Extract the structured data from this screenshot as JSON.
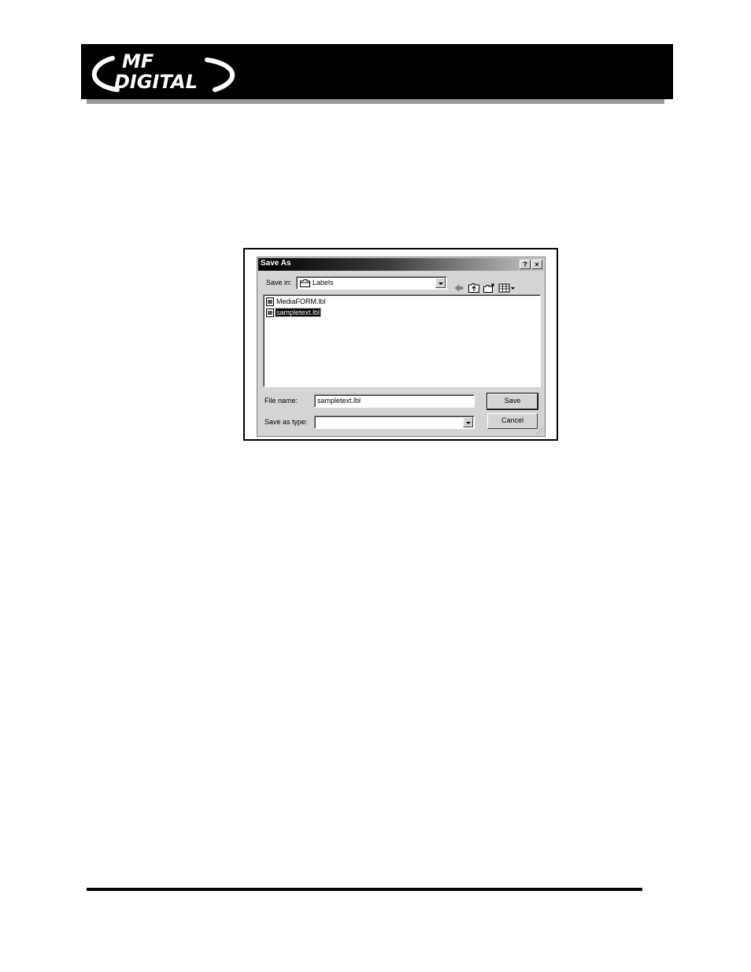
{
  "header": {
    "logo": {
      "line1": "MF",
      "line2": "DIGITAL"
    }
  },
  "dialog": {
    "title": "Save As",
    "help_button": "?",
    "close_button": "×",
    "save_in_label": "Save in:",
    "save_in_value": "Labels",
    "files": [
      {
        "name": "MediaFORM.lbl",
        "selected": false
      },
      {
        "name": "sampletext.lbl",
        "selected": true
      }
    ],
    "file_name_label": "File name:",
    "file_name_value": "sampletext.lbl",
    "save_as_type_label": "Save as type:",
    "save_as_type_value": "",
    "save_button": "Save",
    "cancel_button": "Cancel"
  },
  "icons": {
    "back": "back-arrow-icon",
    "up": "up-folder-icon",
    "new_folder": "new-folder-icon",
    "view_menu": "view-menu-icon",
    "folder": "folder-icon",
    "file": "label-file-icon"
  },
  "colors": {
    "banner": "#000000",
    "dialog_face": "#d4d4d4",
    "title_gradient_start": "#000000",
    "title_gradient_end": "#c8c8c8"
  }
}
